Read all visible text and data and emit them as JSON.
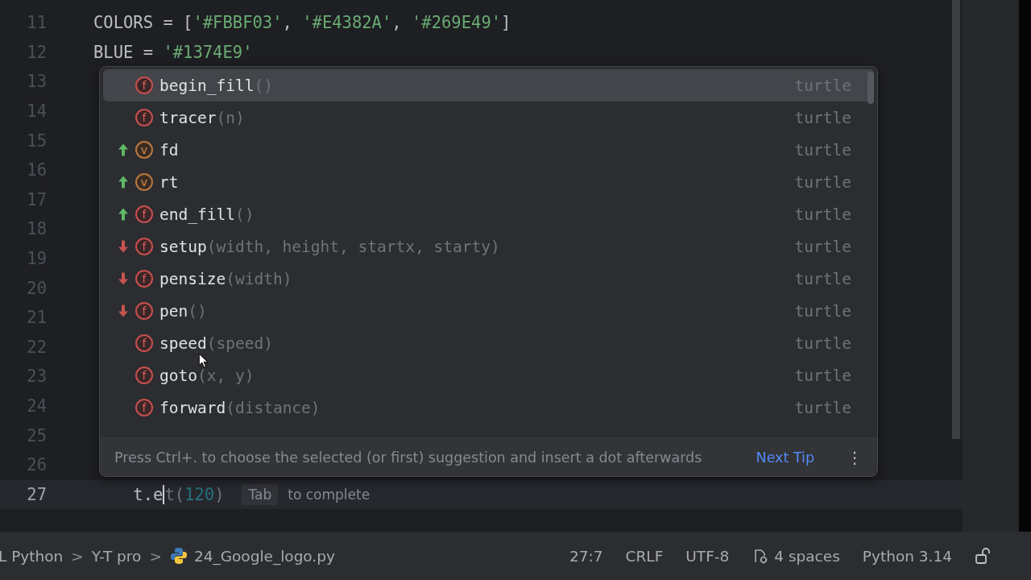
{
  "editor": {
    "lines": [
      {
        "number": "11",
        "current": false,
        "tokens": [
          {
            "text": "COLORS = [",
            "kind": "plain"
          },
          {
            "text": "'#FBBF03'",
            "kind": "string"
          },
          {
            "text": ", ",
            "kind": "plain"
          },
          {
            "text": "'#E4382A'",
            "kind": "string"
          },
          {
            "text": ", ",
            "kind": "plain"
          },
          {
            "text": "'#269E49'",
            "kind": "string"
          },
          {
            "text": "]",
            "kind": "plain"
          }
        ]
      },
      {
        "number": "12",
        "current": false,
        "tokens": [
          {
            "text": "BLUE = ",
            "kind": "plain"
          },
          {
            "text": "'#1374E9'",
            "kind": "string"
          }
        ]
      },
      {
        "number": "13",
        "current": false
      },
      {
        "number": "14",
        "current": false
      },
      {
        "number": "15",
        "current": false
      },
      {
        "number": "16",
        "current": false
      },
      {
        "number": "17",
        "current": false
      },
      {
        "number": "18",
        "current": false
      },
      {
        "number": "19",
        "current": false
      },
      {
        "number": "20",
        "current": false
      },
      {
        "number": "21",
        "current": false
      },
      {
        "number": "22",
        "current": false
      },
      {
        "number": "23",
        "current": false
      },
      {
        "number": "24",
        "current": false
      },
      {
        "number": "25",
        "current": false
      },
      {
        "number": "26",
        "current": false
      },
      {
        "number": "27",
        "current": true,
        "tokens": [
          {
            "text": "    t.e",
            "kind": "plain"
          }
        ],
        "ghost": [
          {
            "text": "t(",
            "kind": "plain"
          },
          {
            "text": "120",
            "kind": "number"
          },
          {
            "text": ")",
            "kind": "plain"
          }
        ],
        "hint": {
          "key": "Tab",
          "text": "to complete"
        }
      }
    ]
  },
  "completion": {
    "items": [
      {
        "kind": "plain",
        "icon": "f",
        "name": "begin_fill",
        "params": "()",
        "type": "turtle",
        "selected": true
      },
      {
        "kind": "plain",
        "icon": "f",
        "name": "tracer",
        "params": "(n)",
        "type": "turtle",
        "selected": false
      },
      {
        "kind": "raised",
        "icon": "v",
        "name": "fd",
        "type": "turtle",
        "selected": false
      },
      {
        "kind": "raised",
        "icon": "v",
        "name": "rt",
        "type": "turtle",
        "selected": false
      },
      {
        "kind": "raised",
        "icon": "f",
        "name": "end_fill",
        "params": "()",
        "type": "turtle",
        "selected": false
      },
      {
        "kind": "lowered",
        "icon": "f",
        "name": "setup",
        "params": "(width, height, startx, starty)",
        "type": "turtle",
        "selected": false
      },
      {
        "kind": "lowered",
        "icon": "f",
        "name": "pensize",
        "params": "(width)",
        "type": "turtle",
        "selected": false
      },
      {
        "kind": "lowered",
        "icon": "f",
        "name": "pen",
        "params": "()",
        "type": "turtle",
        "selected": false
      },
      {
        "kind": "plain",
        "icon": "f",
        "name": "speed",
        "params": "(speed)",
        "type": "turtle",
        "selected": false
      },
      {
        "kind": "plain",
        "icon": "f",
        "name": "goto",
        "params": "(x, y)",
        "type": "turtle",
        "selected": false
      },
      {
        "kind": "plain",
        "icon": "f",
        "name": "forward",
        "params": "(distance)",
        "type": "turtle",
        "selected": false
      }
    ],
    "tip": {
      "text": "Press Ctrl+. to choose the selected (or first) suggestion and insert a dot afterwards",
      "link": "Next Tip",
      "menu": "⋮"
    }
  },
  "status_bar": {
    "breadcrumbs": [
      {
        "text": "L Python",
        "kind": "folder"
      },
      {
        "text": "Y-T pro",
        "kind": "folder"
      },
      {
        "text": "24_Google_logo.py",
        "kind": "python-file"
      }
    ],
    "separator": ">",
    "position": "27:7",
    "line_ending": "CRLF",
    "encoding": "UTF-8",
    "indent": "4 spaces",
    "interpreter": "Python 3.14"
  }
}
